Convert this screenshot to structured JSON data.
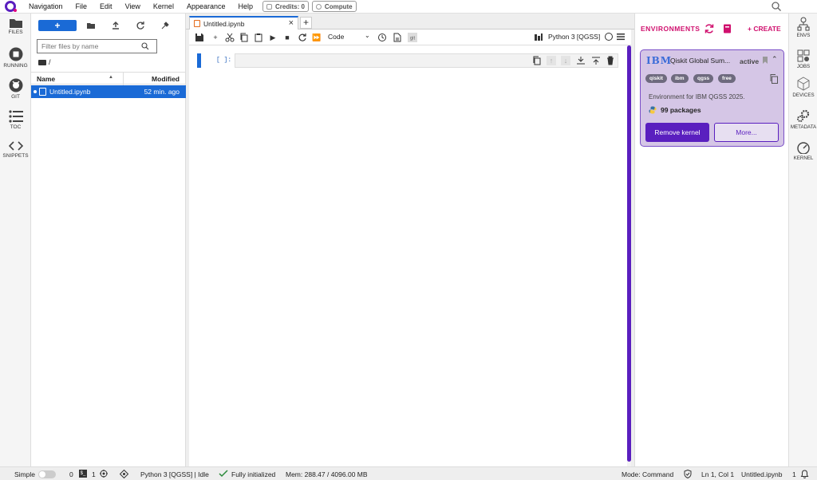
{
  "menubar": {
    "items": [
      "Navigation",
      "File",
      "Edit",
      "View",
      "Kernel",
      "Appearance",
      "Help"
    ],
    "credits_label": "Credits:",
    "credits_value": "0",
    "compute_label": "Compute"
  },
  "left_rail": {
    "files": "FILES",
    "running": "RUNNING",
    "git": "GIT",
    "toc": "TOC",
    "snippets": "SNIPPETS"
  },
  "file_browser": {
    "new_label": "+",
    "filter_placeholder": "Filter files by name",
    "path": "/",
    "col_name": "Name",
    "col_modified": "Modified",
    "files": [
      {
        "name": "Untitled.ipynb",
        "modified": "52 min. ago"
      }
    ]
  },
  "notebook": {
    "tab_label": "Untitled.ipynb",
    "tab_close": "×",
    "tab_add": "+",
    "cell_type": "Code",
    "kernel_name": "Python 3 [QGSS]",
    "cell_prompt": "[ ]:"
  },
  "env_panel": {
    "title": "ENVIRONMENTS",
    "create_label": "+ CREATE",
    "card": {
      "logo": "IBM",
      "name": "Qiskit Global Sum...",
      "status": "active",
      "tags": [
        "qiskit",
        "ibm",
        "qgss",
        "free"
      ],
      "description": "Environment for IBM QGSS 2025.",
      "packages": "99 packages",
      "remove_label": "Remove kernel",
      "more_label": "More..."
    }
  },
  "right_rail": {
    "envs": "ENVS",
    "jobs": "JOBS",
    "devices": "DEVICES",
    "metadata": "METADATA",
    "kernel": "KERNEL"
  },
  "statusbar": {
    "mode_simple": "Simple",
    "terminals": "0",
    "kernels": "1",
    "kernel_status": "Python 3 [QGSS] | Idle",
    "init_status": "Fully initialized",
    "memory": "Mem: 288.47 / 4096.00 MB",
    "command_mode": "Mode: Command",
    "cursor": "Ln 1, Col 1",
    "filename": "Untitled.ipynb",
    "notifications": "1"
  },
  "colors": {
    "accent_blue": "#1a6ad6",
    "brand_purple": "#5a1fbf",
    "brand_pink": "#d0106e",
    "card_bg": "#d5c6e6"
  }
}
